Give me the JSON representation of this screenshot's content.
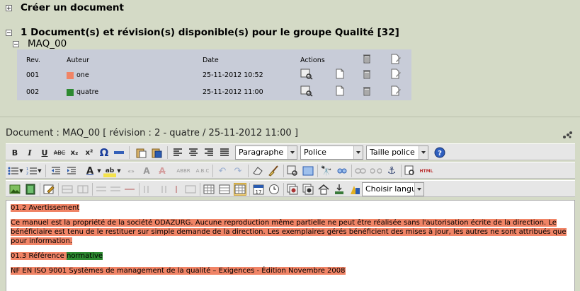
{
  "sections": {
    "create": "Créer un document",
    "group": "1 Document(s) et révision(s) disponible(s) pour le groupe Qualité [32]",
    "document_code": "MAQ_00"
  },
  "table": {
    "headers": [
      "Rev.",
      "Auteur",
      "Date",
      "Actions"
    ],
    "rows": [
      {
        "rev": "001",
        "author": "one",
        "author_color": "#f08466",
        "date": "25-11-2012 10:52"
      },
      {
        "rev": "002",
        "author": "quatre",
        "author_color": "#2d8a31",
        "date": "25-11-2012 11:00"
      }
    ]
  },
  "document_header": "Document : MAQ_00  [ révision : 2 - quatre / 25-11-2012 11:00 ]",
  "toolbar": {
    "format_select": "Paragraphe",
    "font_select": "Police",
    "size_select": "Taille police",
    "language_select": "Choisir langue"
  },
  "editor": {
    "h1": "01.2 Avertissement",
    "p1": "Ce manuel est la propriété de la société ODAZURG. Aucune reproduction même partielle ne peut être réalisée sans l'autorisation écrite de la direction. Le bénéficiaire est tenu de le restituer sur simple demande de la direction. Les exemplaires gérés bénéficient des mises à jour, les autres ne sont attribués que pour information.",
    "h2a": "01.3 Référence ",
    "h2b": "normative",
    "p2": "NF EN ISO 9001 Systèmes de management de la qualité – Exigences - Édition Novembre 2008"
  },
  "colors": {
    "highlight": "#f08466",
    "highlight_green": "#2d8a31",
    "background": "#d4dac6"
  }
}
